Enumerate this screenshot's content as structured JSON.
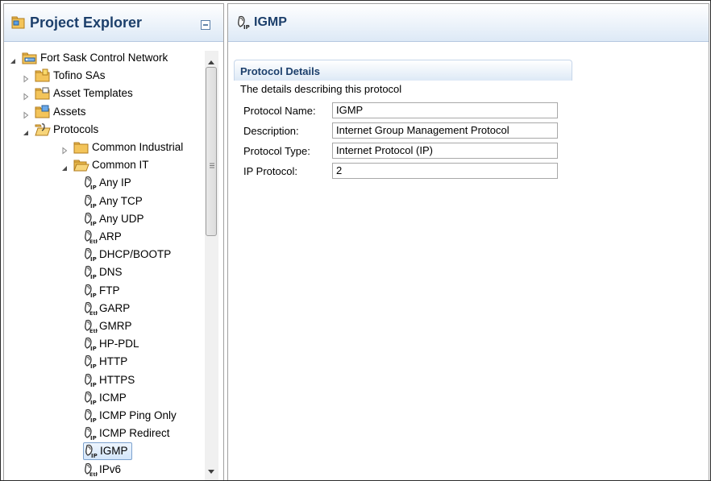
{
  "left": {
    "title": "Project Explorer",
    "tree": [
      {
        "label": "Fort Sask Control Network",
        "twisty": "expanded",
        "icon": "network-folder-icon",
        "level": 0
      },
      {
        "label": "Tofino SAs",
        "twisty": "collapsed",
        "icon": "tofino-folder-icon",
        "level": 1
      },
      {
        "label": "Asset Templates",
        "twisty": "collapsed",
        "icon": "templates-folder-icon",
        "level": 1
      },
      {
        "label": "Assets",
        "twisty": "collapsed",
        "icon": "assets-folder-icon",
        "level": 1
      },
      {
        "label": "Protocols",
        "twisty": "expanded",
        "icon": "protocols-folder-icon",
        "level": 1
      },
      {
        "label": "Common Industrial",
        "twisty": "collapsed",
        "icon": "folder-icon",
        "level": 2
      },
      {
        "label": "Common IT",
        "twisty": "expanded",
        "icon": "folder-open-icon",
        "level": 2
      },
      {
        "label": "Any IP",
        "twisty": "none",
        "icon": "ip-protocol-icon",
        "level": 3
      },
      {
        "label": "Any TCP",
        "twisty": "none",
        "icon": "ip-protocol-icon",
        "level": 3
      },
      {
        "label": "Any UDP",
        "twisty": "none",
        "icon": "ip-protocol-icon",
        "level": 3
      },
      {
        "label": "ARP",
        "twisty": "none",
        "icon": "eth-protocol-icon",
        "level": 3
      },
      {
        "label": "DHCP/BOOTP",
        "twisty": "none",
        "icon": "ip-protocol-icon",
        "level": 3
      },
      {
        "label": "DNS",
        "twisty": "none",
        "icon": "ip-protocol-icon",
        "level": 3
      },
      {
        "label": "FTP",
        "twisty": "none",
        "icon": "ip-protocol-icon",
        "level": 3
      },
      {
        "label": "GARP",
        "twisty": "none",
        "icon": "eth-protocol-icon",
        "level": 3
      },
      {
        "label": "GMRP",
        "twisty": "none",
        "icon": "eth-protocol-icon",
        "level": 3
      },
      {
        "label": "HP-PDL",
        "twisty": "none",
        "icon": "ip-protocol-icon",
        "level": 3
      },
      {
        "label": "HTTP",
        "twisty": "none",
        "icon": "ip-protocol-icon",
        "level": 3
      },
      {
        "label": "HTTPS",
        "twisty": "none",
        "icon": "ip-protocol-icon",
        "level": 3
      },
      {
        "label": "ICMP",
        "twisty": "none",
        "icon": "ip-protocol-icon",
        "level": 3
      },
      {
        "label": "ICMP Ping Only",
        "twisty": "none",
        "icon": "ip-protocol-icon",
        "level": 3
      },
      {
        "label": "ICMP Redirect",
        "twisty": "none",
        "icon": "ip-protocol-icon",
        "level": 3
      },
      {
        "label": "IGMP",
        "twisty": "none",
        "icon": "ip-protocol-icon",
        "level": 3,
        "selected": true
      },
      {
        "label": "IPv6",
        "twisty": "none",
        "icon": "eth-protocol-icon",
        "level": 3
      }
    ]
  },
  "right": {
    "title": "IGMP",
    "section_title": "Protocol Details",
    "section_desc": "The details describing this protocol",
    "fields": [
      {
        "label": "Protocol Name:",
        "value": "IGMP"
      },
      {
        "label": "Description:",
        "value": "Internet Group Management Protocol"
      },
      {
        "label": "Protocol Type:",
        "value": "Internet Protocol (IP)"
      },
      {
        "label": "IP Protocol:",
        "value": "2"
      }
    ]
  }
}
